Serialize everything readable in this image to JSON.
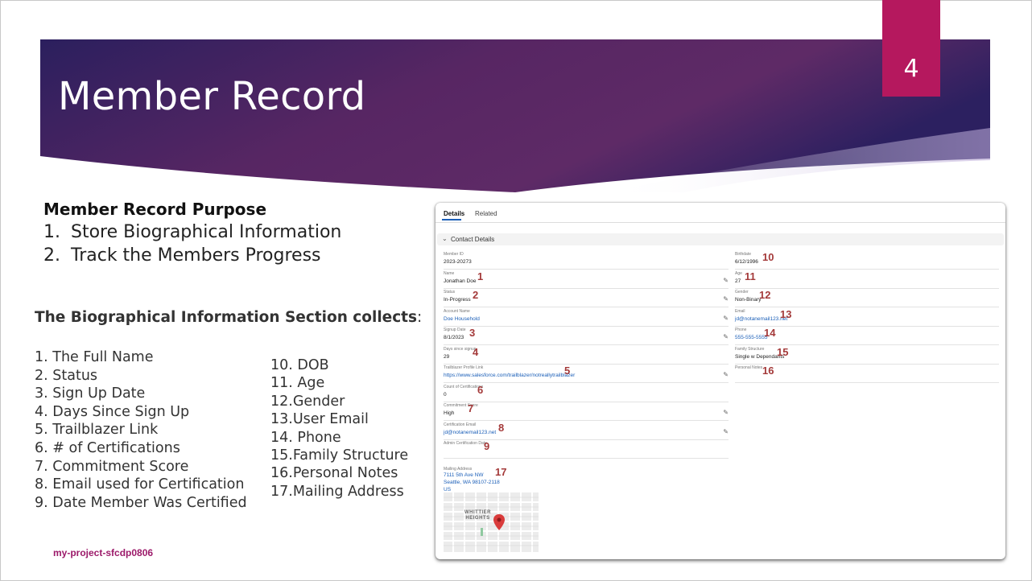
{
  "slide": {
    "title": "Member Record",
    "page_number": "4",
    "footer": "my-project-sfcdp0806"
  },
  "purpose": {
    "heading": "Member Record Purpose",
    "items": [
      {
        "num": "1.",
        "text": "Store Biographical Information"
      },
      {
        "num": "2.",
        "text": "Track the Members Progress"
      }
    ]
  },
  "bio": {
    "heading": "The Biographical Information Section collects",
    "colon": ":",
    "col1": [
      "1. The Full Name",
      "2. Status",
      "3. Sign Up Date",
      "4. Days Since Sign Up",
      "5. Trailblazer Link",
      "6. # of Certifications",
      "7. Commitment Score",
      "8. Email used for Certification",
      "9. Date Member Was Certified"
    ],
    "col2": [
      "10. DOB",
      "11. Age",
      "12.Gender",
      "13.User Email",
      "14. Phone",
      "15.Family Structure",
      "16.Personal Notes",
      "17.Mailing Address"
    ]
  },
  "record": {
    "tabs": [
      "Details",
      "Related"
    ],
    "section": "Contact Details",
    "left_fields": [
      {
        "label": "Member ID",
        "value": "2023-20273",
        "link": false,
        "editable": false,
        "badge": ""
      },
      {
        "label": "Name",
        "value": "Jonathan Doe",
        "link": false,
        "editable": true,
        "badge": "1"
      },
      {
        "label": "Status",
        "value": "In-Progress",
        "link": false,
        "editable": true,
        "badge": "2"
      },
      {
        "label": "Account Name",
        "value": "Doe Household",
        "link": true,
        "editable": true,
        "badge": ""
      },
      {
        "label": "Signup Date",
        "value": "8/1/2023",
        "link": false,
        "editable": true,
        "badge": "3"
      },
      {
        "label": "Days since signup",
        "value": "29",
        "link": false,
        "editable": false,
        "badge": "4"
      },
      {
        "label": "Trailblazer Profile Link",
        "value": "https://www.salesforce.com/trailblazer/notreallytrailblazer",
        "link": true,
        "editable": true,
        "badge": "5"
      },
      {
        "label": "Count of Certifications",
        "value": "0",
        "link": false,
        "editable": false,
        "badge": "6"
      },
      {
        "label": "Commitment Score",
        "value": "High",
        "link": false,
        "editable": true,
        "badge": "7"
      },
      {
        "label": "Certification Email",
        "value": "jd@notanemail123.net",
        "link": true,
        "editable": true,
        "badge": "8"
      },
      {
        "label": "Admin Certification Date",
        "value": "",
        "link": false,
        "editable": false,
        "badge": "9"
      }
    ],
    "right_fields": [
      {
        "label": "Birthdate",
        "value": "6/12/1996",
        "link": false,
        "badge": "10"
      },
      {
        "label": "Age",
        "value": "27",
        "link": false,
        "badge": "11"
      },
      {
        "label": "Gender",
        "value": "Non-Binary",
        "link": false,
        "badge": "12"
      },
      {
        "label": "Email",
        "value": "jd@notanemail123.net",
        "link": true,
        "badge": "13"
      },
      {
        "label": "Phone",
        "value": "555-555-5555",
        "link": true,
        "badge": "14"
      },
      {
        "label": "Family Structure",
        "value": "Single w Dependants",
        "link": false,
        "badge": "15"
      },
      {
        "label": "Personal Notes",
        "value": "",
        "link": false,
        "badge": "16"
      }
    ],
    "address": {
      "label": "Mailing Address",
      "lines": [
        "7111 5th Ave NW",
        "Seattle, WA 98107-2118",
        "US"
      ],
      "badge": "17"
    },
    "map_label": [
      "WHITTIER",
      "HEIGHTS"
    ]
  },
  "colors": {
    "accent": "#b5185e",
    "banner_dark": "#2a1d5c",
    "banner_light": "#7a2a6a",
    "badge": "#a43a3a",
    "link": "#1b5fb8",
    "footer": "#9c1a6a"
  },
  "icons": {
    "edit": "pencil-icon",
    "collapse": "chevron-down-icon",
    "map_pin": "map-pin-icon"
  }
}
